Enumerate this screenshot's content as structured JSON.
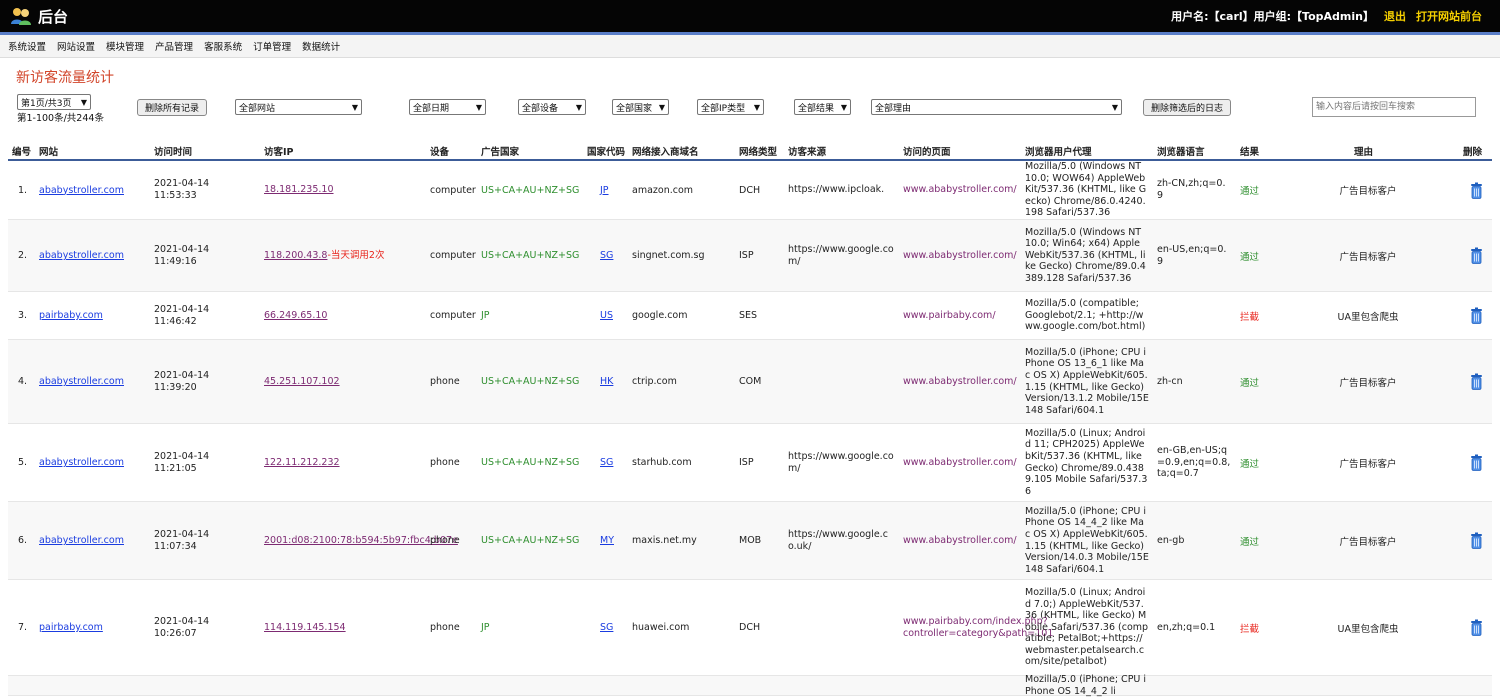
{
  "header": {
    "title": "后台",
    "user_info": "用户名:【carl】用户组:【TopAdmin】",
    "logout": "退出",
    "open_front": "打开网站前台"
  },
  "menu": [
    "系统设置",
    "网站设置",
    "模块管理",
    "产品管理",
    "客服系统",
    "订单管理",
    "数据统计"
  ],
  "page_title": "新访客流量统计",
  "toolbar": {
    "page_select": "第1页/共3页",
    "summary": "第1-100条/共244条",
    "delete_all": "删除所有记录",
    "site_filter": "全部网站",
    "date_filter": "全部日期",
    "device_filter": "全部设备",
    "country_filter": "全部国家",
    "iptype_filter": "全部IP类型",
    "result_filter": "全部结果",
    "reason_filter": "全部理由",
    "delete_filtered": "删除筛选后的日志",
    "search_placeholder": "输入内容后请按回车搜索"
  },
  "columns": [
    "编号",
    "网站",
    "访问时间",
    "访客IP",
    "设备",
    "广告国家",
    "国家代码",
    "网络接入商域名",
    "网络类型",
    "访客来源",
    "访问的页面",
    "浏览器用户代理",
    "浏览器语言",
    "结果",
    "理由",
    "删除"
  ],
  "rows": [
    {
      "no": "1.",
      "site": "ababystroller.com",
      "time1": "2021-04-14",
      "time2": "11:53:33",
      "ip": "18.181.235.10",
      "ip_note": "",
      "device": "computer",
      "ad_country": "US+CA+AU+NZ+SG",
      "ccode": "JP",
      "isp": "amazon.com",
      "net": "DCH",
      "ref": "https://www.ipcloak.",
      "page": "www.ababystroller.com/",
      "ua": "Mozilla/5.0 (Windows NT 10.0; WOW64) AppleWebKit/537.36 (KHTML, like Gecko) Chrome/86.0.4240.198 Safari/537.36",
      "lang": "zh-CN,zh;q=0.9",
      "result": "通过",
      "result_color": "#2f8f2f",
      "reason": "广告目标客户"
    },
    {
      "no": "2.",
      "site": "ababystroller.com",
      "time1": "2021-04-14",
      "time2": "11:49:16",
      "ip": "118.200.43.8",
      "ip_note": "-当天调用2次",
      "device": "computer",
      "ad_country": "US+CA+AU+NZ+SG",
      "ccode": "SG",
      "isp": "singnet.com.sg",
      "net": "ISP",
      "ref": "https://www.google.com/",
      "page": "www.ababystroller.com/",
      "ua": "Mozilla/5.0 (Windows NT 10.0; Win64; x64) AppleWebKit/537.36 (KHTML, like Gecko) Chrome/89.0.4389.128 Safari/537.36",
      "lang": "en-US,en;q=0.9",
      "result": "通过",
      "result_color": "#2f8f2f",
      "reason": "广告目标客户"
    },
    {
      "no": "3.",
      "site": "pairbaby.com",
      "time1": "2021-04-14",
      "time2": "11:46:42",
      "ip": "66.249.65.10",
      "ip_note": "",
      "device": "computer",
      "ad_country": "JP",
      "ccode": "US",
      "isp": "google.com",
      "net": "SES",
      "ref": "",
      "page": "www.pairbaby.com/",
      "ua": "Mozilla/5.0 (compatible; Googlebot/2.1; +http://www.google.com/bot.html)",
      "lang": "",
      "result": "拦截",
      "result_color": "#e8231b",
      "reason": "UA里包含爬虫"
    },
    {
      "no": "4.",
      "site": "ababystroller.com",
      "time1": "2021-04-14",
      "time2": "11:39:20",
      "ip": "45.251.107.102",
      "ip_note": "",
      "device": "phone",
      "ad_country": "US+CA+AU+NZ+SG",
      "ccode": "HK",
      "isp": "ctrip.com",
      "net": "COM",
      "ref": "",
      "page": "www.ababystroller.com/",
      "ua": "Mozilla/5.0 (iPhone; CPU iPhone OS 13_6_1 like Mac OS X) AppleWebKit/605.1.15 (KHTML, like Gecko) Version/13.1.2 Mobile/15E148 Safari/604.1",
      "lang": "zh-cn",
      "result": "通过",
      "result_color": "#2f8f2f",
      "reason": "广告目标客户"
    },
    {
      "no": "5.",
      "site": "ababystroller.com",
      "time1": "2021-04-14",
      "time2": "11:21:05",
      "ip": "122.11.212.232",
      "ip_note": "",
      "device": "phone",
      "ad_country": "US+CA+AU+NZ+SG",
      "ccode": "SG",
      "isp": "starhub.com",
      "net": "ISP",
      "ref": "https://www.google.com/",
      "page": "www.ababystroller.com/",
      "ua": "Mozilla/5.0 (Linux; Android 11; CPH2025) AppleWebKit/537.36 (KHTML, like Gecko) Chrome/89.0.4389.105 Mobile Safari/537.36",
      "lang": "en-GB,en-US;q=0.9,en;q=0.8,ta;q=0.7",
      "result": "通过",
      "result_color": "#2f8f2f",
      "reason": "广告目标客户"
    },
    {
      "no": "6.",
      "site": "ababystroller.com",
      "time1": "2021-04-14",
      "time2": "11:07:34",
      "ip": "2001:d08:2100:78:b594:5b97:fbc4:b07e",
      "ip_note": "",
      "device": "phone",
      "ad_country": "US+CA+AU+NZ+SG",
      "ccode": "MY",
      "isp": "maxis.net.my",
      "net": "MOB",
      "ref": "https://www.google.co.uk/",
      "page": "www.ababystroller.com/",
      "ua": "Mozilla/5.0 (iPhone; CPU iPhone OS 14_4_2 like Mac OS X) AppleWebKit/605.1.15 (KHTML, like Gecko) Version/14.0.3 Mobile/15E148 Safari/604.1",
      "lang": "en-gb",
      "result": "通过",
      "result_color": "#2f8f2f",
      "reason": "广告目标客户"
    },
    {
      "no": "7.",
      "site": "pairbaby.com",
      "time1": "2021-04-14",
      "time2": "10:26:07",
      "ip": "114.119.145.154",
      "ip_note": "",
      "device": "phone",
      "ad_country": "JP",
      "ccode": "SG",
      "isp": "huawei.com",
      "net": "DCH",
      "ref": "",
      "page": "www.pairbaby.com/index.php?controller=category&path=101",
      "ua": "Mozilla/5.0 (Linux; Android 7.0;) AppleWebKit/537.36 (KHTML, like Gecko) Mobile Safari/537.36 (compatible; PetalBot;+https://webmaster.petalsearch.com/site/petalbot)",
      "lang": "en,zh;q=0.1",
      "result": "拦截",
      "result_color": "#e8231b",
      "reason": "UA里包含爬虫"
    },
    {
      "no": "",
      "site": "",
      "time1": "",
      "time2": "",
      "ip": "",
      "ip_note": "",
      "device": "",
      "ad_country": "",
      "ccode": "",
      "isp": "",
      "net": "",
      "ref": "",
      "page": "",
      "ua": "Mozilla/5.0 (iPhone; CPU iPhone OS 14_4_2 li",
      "lang": "",
      "result": "",
      "result_color": "#2f8f2f",
      "reason": ""
    }
  ],
  "colors": {
    "accent_bar": "#5a7ec8",
    "title_red": "#d2462b",
    "link_blue": "#1a3ce0",
    "visited_purple": "#7d2a72",
    "pass_green": "#2f8f2f",
    "block_red": "#e8231b"
  }
}
